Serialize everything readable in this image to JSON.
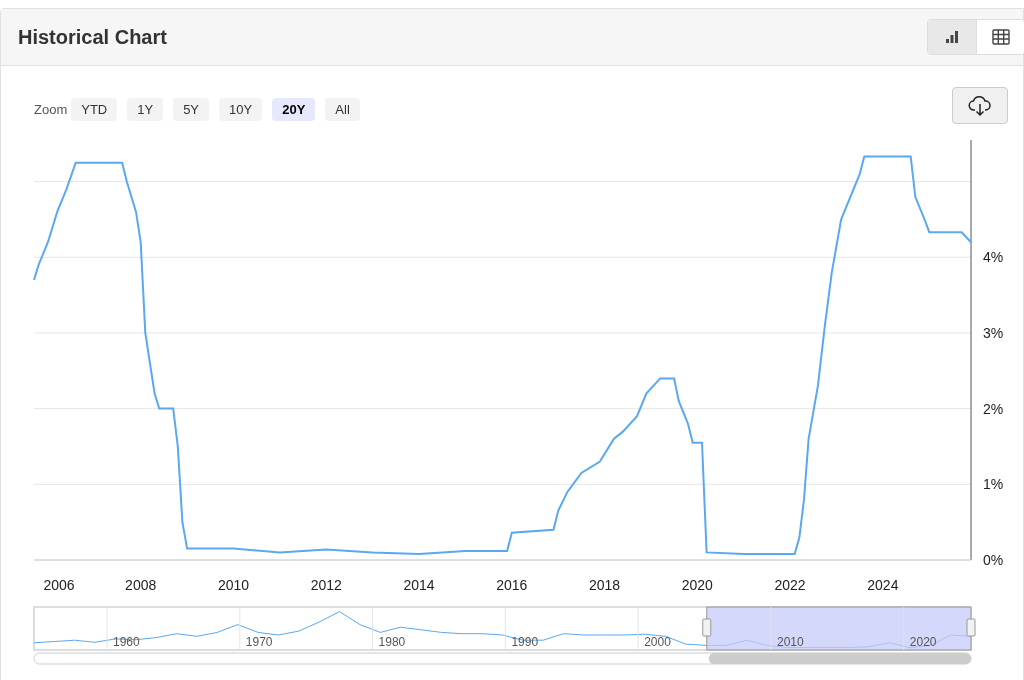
{
  "header": {
    "title": "Historical Chart",
    "views": [
      {
        "kind": "chart",
        "selected": true
      },
      {
        "kind": "table",
        "selected": false
      }
    ]
  },
  "toolbar": {
    "zoom_label": "Zoom",
    "ranges": [
      {
        "label": "YTD",
        "selected": false
      },
      {
        "label": "1Y",
        "selected": false
      },
      {
        "label": "5Y",
        "selected": false
      },
      {
        "label": "10Y",
        "selected": false
      },
      {
        "label": "20Y",
        "selected": true
      },
      {
        "label": "All",
        "selected": false
      }
    ]
  },
  "chart": {
    "chart_data": {
      "type": "line",
      "grid": true,
      "xlim": [
        2005.7,
        2025.9
      ],
      "ylim": [
        0,
        5.55
      ],
      "xticks": [
        2006,
        2008,
        2010,
        2012,
        2014,
        2016,
        2018,
        2020,
        2022,
        2024
      ],
      "yticks": [
        {
          "value": 0,
          "label": "0%"
        },
        {
          "value": 1,
          "label": "1%"
        },
        {
          "value": 2,
          "label": "2%"
        },
        {
          "value": 3,
          "label": "3%"
        },
        {
          "value": 4,
          "label": "4%"
        }
      ],
      "x": [
        2005.7,
        2005.8,
        2006.0,
        2006.2,
        2006.4,
        2006.6,
        2007.0,
        2007.6,
        2007.7,
        2007.9,
        2008.0,
        2008.1,
        2008.3,
        2008.4,
        2008.7,
        2008.8,
        2008.9,
        2009.0,
        2010.0,
        2011.0,
        2012.0,
        2013.0,
        2014.0,
        2015.0,
        2015.9,
        2016.0,
        2016.9,
        2017.0,
        2017.2,
        2017.5,
        2017.9,
        2018.2,
        2018.4,
        2018.7,
        2018.9,
        2019.2,
        2019.5,
        2019.6,
        2019.8,
        2019.9,
        2020.1,
        2020.2,
        2021.0,
        2022.1,
        2022.2,
        2022.3,
        2022.4,
        2022.6,
        2022.75,
        2022.9,
        2023.1,
        2023.3,
        2023.5,
        2023.6,
        2024.6,
        2024.7,
        2024.9,
        2025.0,
        2025.7,
        2025.9
      ],
      "series": [
        {
          "color": "#5aa8f0",
          "values": [
            3.7,
            3.9,
            4.2,
            4.6,
            4.9,
            5.25,
            5.25,
            5.25,
            5.0,
            4.6,
            4.2,
            3.0,
            2.2,
            2.0,
            2.0,
            1.5,
            0.5,
            0.15,
            0.15,
            0.1,
            0.14,
            0.1,
            0.08,
            0.12,
            0.12,
            0.36,
            0.4,
            0.65,
            0.9,
            1.15,
            1.3,
            1.6,
            1.7,
            1.9,
            2.2,
            2.4,
            2.4,
            2.1,
            1.8,
            1.55,
            1.55,
            0.1,
            0.08,
            0.08,
            0.3,
            0.8,
            1.6,
            2.3,
            3.1,
            3.8,
            4.5,
            4.8,
            5.1,
            5.33,
            5.33,
            4.8,
            4.5,
            4.33,
            4.33,
            4.2
          ]
        }
      ]
    }
  },
  "navigator": {
    "labels": [
      "1960",
      "1970",
      "1980",
      "1990",
      "2000",
      "2010",
      "2020"
    ]
  }
}
